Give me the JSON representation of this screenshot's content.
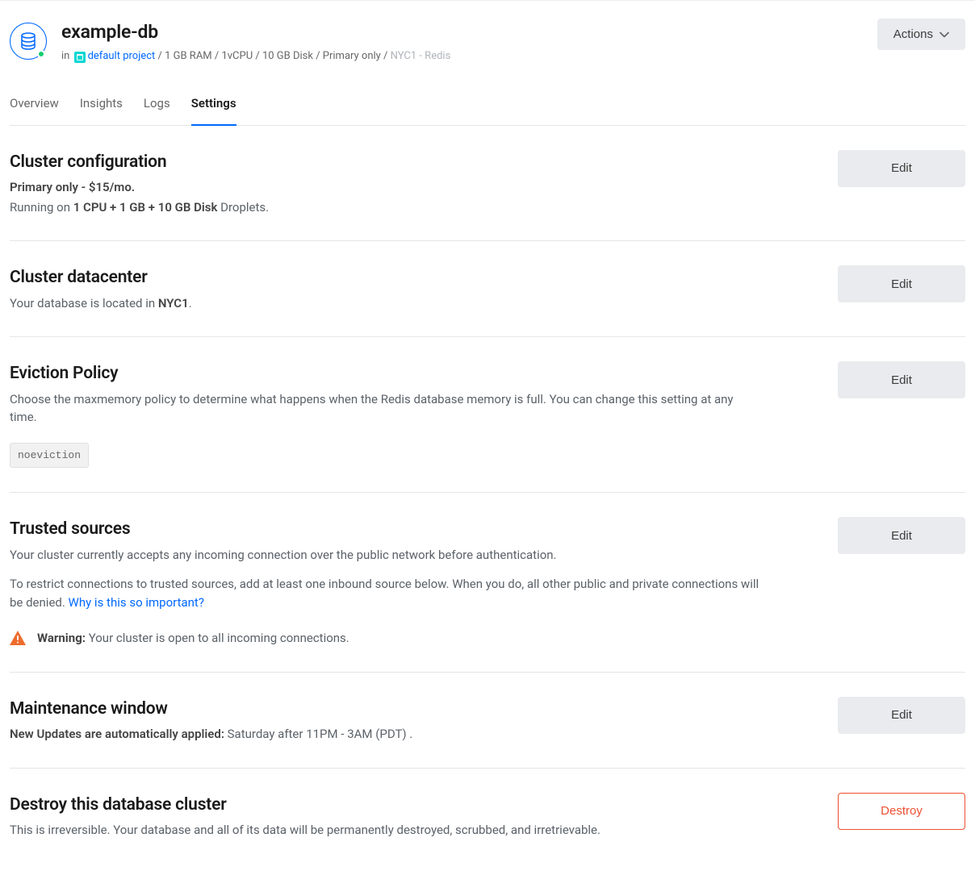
{
  "header": {
    "title": "example-db",
    "in": "in",
    "project": "default project",
    "sep": " / ",
    "specs": "1 GB RAM / 1vCPU / 10 GB Disk / Primary only",
    "region_engine": "NYC1 - Redis",
    "actions_label": "Actions"
  },
  "tabs": {
    "overview": "Overview",
    "insights": "Insights",
    "logs": "Logs",
    "settings": "Settings"
  },
  "cluster_config": {
    "title": "Cluster configuration",
    "plan": "Primary only - $15/mo.",
    "running_prefix": "Running on ",
    "running_spec": "1 CPU + 1 GB + 10 GB Disk",
    "running_suffix": " Droplets.",
    "edit": "Edit"
  },
  "datacenter": {
    "title": "Cluster datacenter",
    "desc_prefix": "Your database is located in ",
    "region": "NYC1",
    "desc_suffix": ".",
    "edit": "Edit"
  },
  "eviction": {
    "title": "Eviction Policy",
    "desc": "Choose the maxmemory policy to determine what happens when the Redis database memory is full. You can change this setting at any time.",
    "value": "noeviction",
    "edit": "Edit"
  },
  "trusted": {
    "title": "Trusted sources",
    "desc1": "Your cluster currently accepts any incoming connection over the public network before authentication.",
    "desc2_prefix": "To restrict connections to trusted sources, add at least one inbound source below. When you do, all other public and private connections will be denied. ",
    "why_link": "Why is this so important?",
    "warn_label": "Warning:",
    "warn_text": " Your cluster is open to all incoming connections.",
    "edit": "Edit"
  },
  "maintenance": {
    "title": "Maintenance window",
    "label": "New Updates are automatically applied:",
    "schedule": " Saturday after 11PM - 3AM (PDT) .",
    "edit": "Edit"
  },
  "destroy": {
    "title": "Destroy this database cluster",
    "desc": "This is irreversible. Your database and all of its data will be permanently destroyed, scrubbed, and irretrievable.",
    "button": "Destroy"
  }
}
